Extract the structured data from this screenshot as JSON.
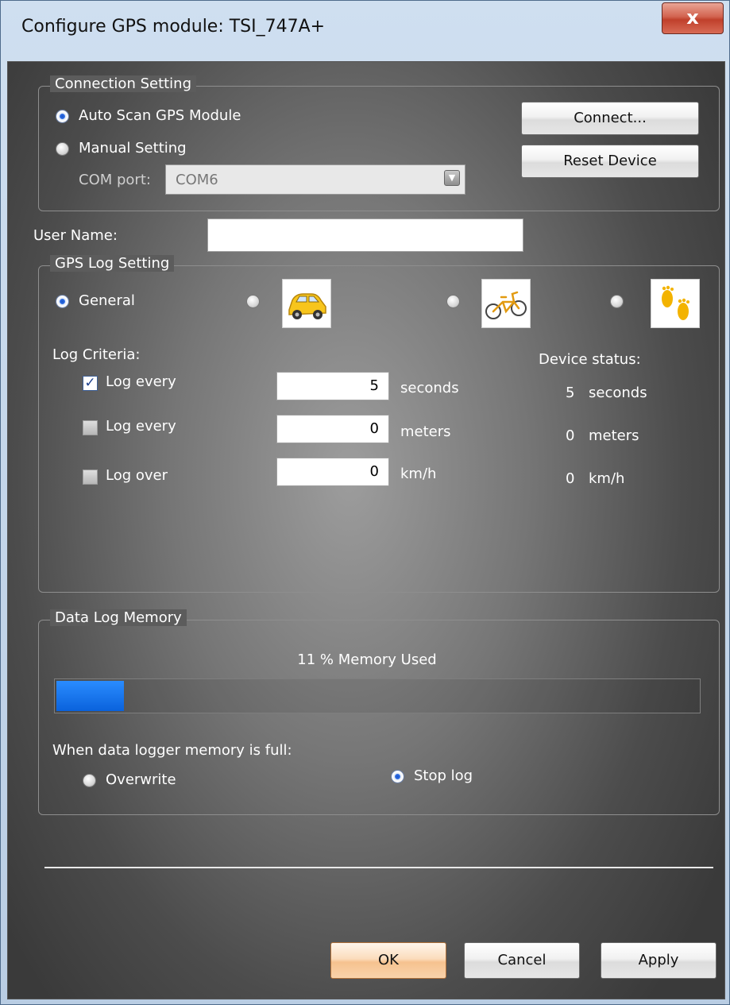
{
  "window": {
    "title": "Configure GPS module: TSI_747A+",
    "close_glyph": "x"
  },
  "connection": {
    "legend": "Connection Setting",
    "auto_scan_label": "Auto Scan GPS Module",
    "manual_label": "Manual Setting",
    "mode_selected": "auto",
    "com_port_label": "COM port:",
    "com_port_value": "COM6",
    "connect_label": "Connect...",
    "reset_label": "Reset Device"
  },
  "user": {
    "label": "User Name:",
    "value": ""
  },
  "gps_log": {
    "legend": "GPS Log Setting",
    "profiles": [
      {
        "id": "general",
        "label": "General",
        "selected": true
      },
      {
        "id": "car",
        "icon": "car-icon",
        "selected": false
      },
      {
        "id": "bicycle",
        "icon": "bicycle-icon",
        "selected": false
      },
      {
        "id": "walking",
        "icon": "footprints-icon",
        "selected": false
      }
    ],
    "criteria_label": "Log Criteria:",
    "status_label": "Device status:",
    "criteria": [
      {
        "label": "Log every",
        "checked": true,
        "value": "5",
        "unit": "seconds",
        "status_value": "5",
        "status_unit": "seconds"
      },
      {
        "label": "Log every",
        "checked": false,
        "value": "0",
        "unit": "meters",
        "status_value": "0",
        "status_unit": "meters"
      },
      {
        "label": "Log over",
        "checked": false,
        "value": "0",
        "unit": "km/h",
        "status_value": "0",
        "status_unit": "km/h"
      }
    ]
  },
  "memory": {
    "legend": "Data Log Memory",
    "used_text": "11 % Memory Used",
    "used_percent": 11,
    "full_label": "When data logger memory is full:",
    "overwrite_label": "Overwrite",
    "stop_label": "Stop log",
    "full_action_selected": "stop"
  },
  "buttons": {
    "ok": "OK",
    "cancel": "Cancel",
    "apply": "Apply"
  },
  "colors": {
    "progress": "#1577f0",
    "ok_accent": "#f6c28f"
  }
}
